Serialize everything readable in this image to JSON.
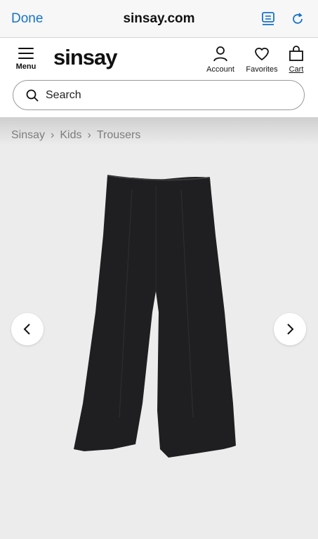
{
  "browser": {
    "done_label": "Done",
    "url": "sinsay.com",
    "icons": {
      "reader": "reader-icon",
      "reload": "reload-icon"
    }
  },
  "header": {
    "menu_label": "Menu",
    "logo": "sinsay",
    "account_label": "Account",
    "favorites_label": "Favorites",
    "cart_label": "Cart"
  },
  "search": {
    "placeholder": "Search"
  },
  "breadcrumb": [
    "Sinsay",
    "Kids",
    "Trousers"
  ],
  "colors": {
    "accent": "#1673c7",
    "background": "#ececec",
    "product": "#1f1f21"
  }
}
